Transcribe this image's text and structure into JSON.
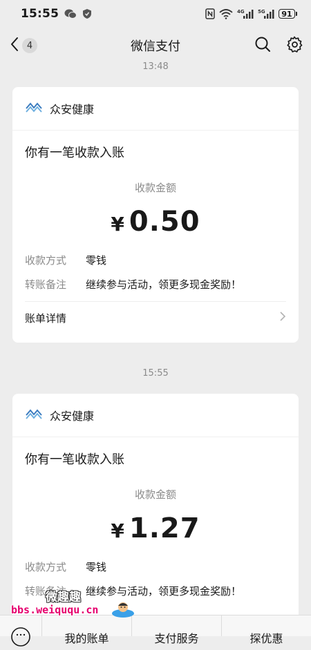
{
  "status_bar": {
    "time": "15:55",
    "battery": "91",
    "network_4g": "4G",
    "network_5g": "5G"
  },
  "nav": {
    "back_badge": "4",
    "title": "微信支付"
  },
  "timestamps": [
    "13:48",
    "15:55"
  ],
  "cards": [
    {
      "merchant": "众安健康",
      "title": "你有一笔收款入账",
      "amount_label": "收款金额",
      "currency": "¥",
      "amount": "0.50",
      "details": [
        {
          "key": "收款方式",
          "value": "零钱"
        },
        {
          "key": "转账备注",
          "value": "继续参与活动，领更多现金奖励！"
        }
      ],
      "footer": "账单详情"
    },
    {
      "merchant": "众安健康",
      "title": "你有一笔收款入账",
      "amount_label": "收款金额",
      "currency": "¥",
      "amount": "1.27",
      "details": [
        {
          "key": "收款方式",
          "value": "零钱"
        },
        {
          "key": "转账备注",
          "value": "继续参与活动，领更多现金奖励！"
        }
      ]
    }
  ],
  "bottom_menu": [
    "我的账单",
    "支付服务",
    "探优惠"
  ],
  "watermark": {
    "name": "微趣趣",
    "url": "bbs.weiququ.cn"
  },
  "colors": {
    "background": "#ededed",
    "card": "#ffffff",
    "muted_text": "#8a8a8a",
    "primary_text": "#191919",
    "logo": "#3a7bbf"
  }
}
